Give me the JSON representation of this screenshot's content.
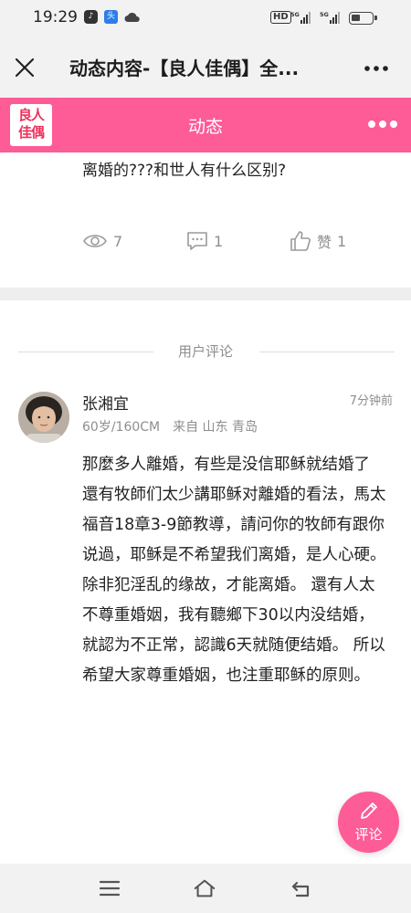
{
  "status_bar": {
    "time": "19:29",
    "network_label": "HD",
    "signal_1": "5G",
    "signal_2": "5G"
  },
  "title_bar": {
    "title": "动态内容-【良人佳偶】全..."
  },
  "header": {
    "logo_line1": "良人",
    "logo_line2": "佳偶",
    "title": "动态",
    "accent_color": "#fd5c96"
  },
  "post": {
    "text": "离婚的???和世人有什么区别?",
    "views": "7",
    "comments": "1",
    "like_label": "赞",
    "likes": "1"
  },
  "comments_section": {
    "title": "用户评论"
  },
  "comment": {
    "name": "张湘宜",
    "time": "7分钟前",
    "age_height": "60岁/160CM",
    "location": "来自 山东 青岛",
    "body": "那麼多人離婚，有些是没信耶稣就结婚了 還有牧師们太少講耶稣对離婚的看法，馬太福音18章3-9節教導，請问你的牧師有跟你说過，耶稣是不希望我们离婚，是人心硬。除非犯淫乱的缘故，才能离婚。 還有人太不尊重婚姻，我有聽鄉下30以内没结婚，就認为不正常，認識6天就随便结婚。 所以希望大家尊重婚姻，也注重耶稣的原则。"
  },
  "fab": {
    "label": "评论"
  }
}
